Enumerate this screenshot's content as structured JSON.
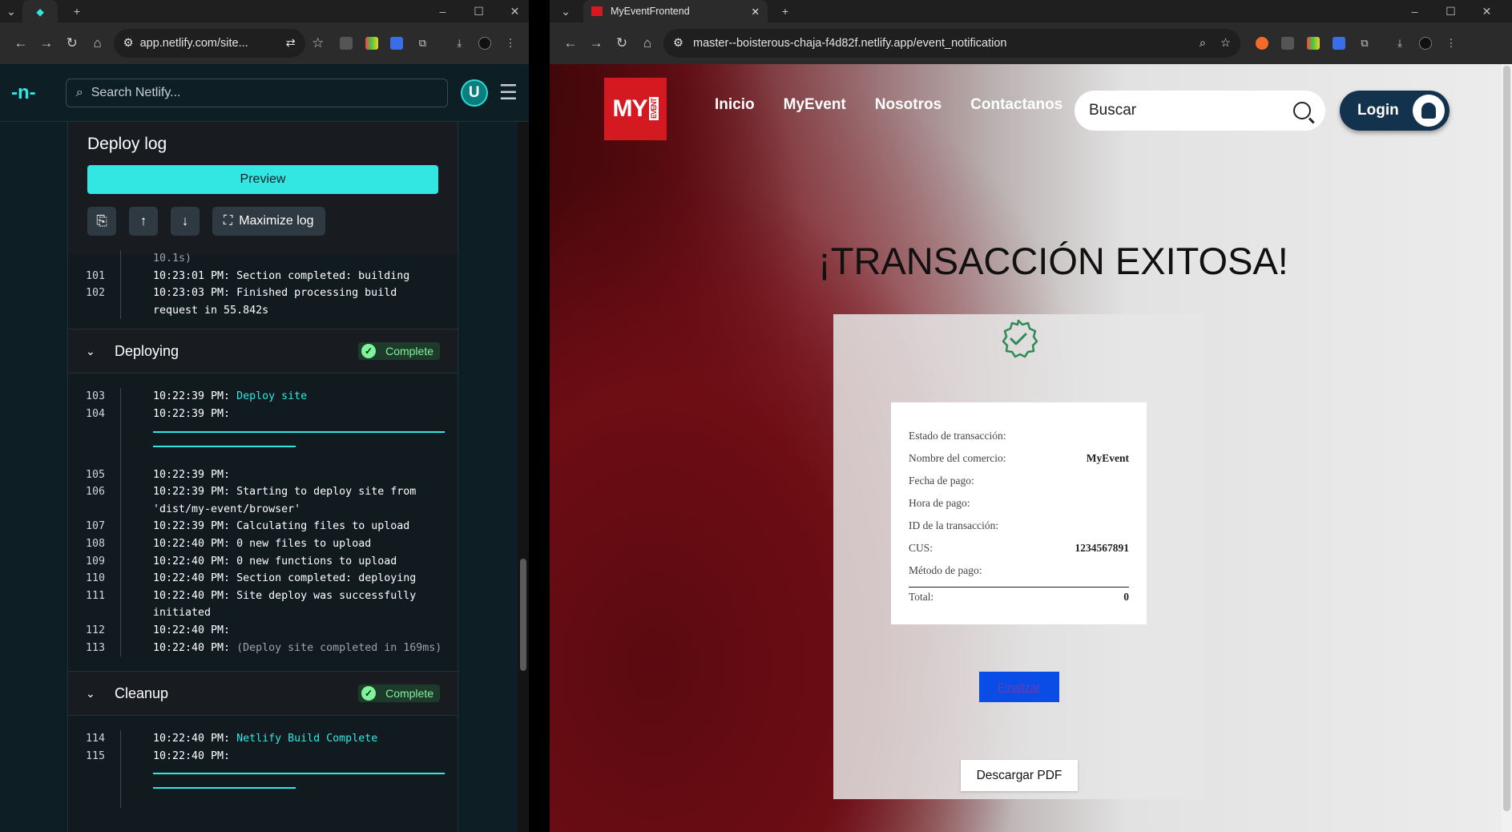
{
  "left_browser": {
    "url": "app.netlify.com/site...",
    "netlify": {
      "search_placeholder": "Search Netlify...",
      "avatar_initial": "U",
      "deploy_log_title": "Deploy log",
      "preview_label": "Preview",
      "maximize_label": "Maximize log",
      "log_top": [
        {
          "num": "",
          "text": "10.1s)",
          "cls": "dim"
        },
        {
          "num": "101",
          "text": "10:23:01 PM: Section completed: building"
        },
        {
          "num": "102",
          "text": "10:23:03 PM: Finished processing build request in 55.842s"
        }
      ],
      "sections": [
        {
          "title": "Deploying",
          "status": "Complete"
        },
        {
          "title": "Cleanup",
          "status": "Complete"
        }
      ],
      "log_deploying": [
        {
          "num": "103",
          "time": "10:22:39 PM:",
          "msg": "Deploy site",
          "cls": "hl"
        },
        {
          "num": "104",
          "time": "10:22:39 PM:",
          "msg": ""
        },
        {
          "num": "105",
          "time": "10:22:39 PM:",
          "msg": ""
        },
        {
          "num": "106",
          "time": "10:22:39 PM:",
          "msg": "Starting to deploy site from 'dist/my-event/browser'"
        },
        {
          "num": "107",
          "time": "10:22:39 PM:",
          "msg": "Calculating files to upload"
        },
        {
          "num": "108",
          "time": "10:22:40 PM:",
          "msg": "0 new files to upload"
        },
        {
          "num": "109",
          "time": "10:22:40 PM:",
          "msg": "0 new functions to upload"
        },
        {
          "num": "110",
          "time": "10:22:40 PM:",
          "msg": "Section completed: deploying"
        },
        {
          "num": "111",
          "time": "10:22:40 PM:",
          "msg": "Site deploy was successfully initiated"
        },
        {
          "num": "112",
          "time": "10:22:40 PM:",
          "msg": ""
        },
        {
          "num": "113",
          "time": "10:22:40 PM:",
          "msg": "(Deploy site completed in 169ms)",
          "cls": "dim"
        }
      ],
      "log_cleanup": [
        {
          "num": "114",
          "time": "10:22:40 PM:",
          "msg": "Netlify Build Complete",
          "cls": "hl"
        },
        {
          "num": "115",
          "time": "10:22:40 PM:",
          "msg": ""
        }
      ]
    }
  },
  "right_browser": {
    "tab_title": "MyEventFrontend",
    "url": "master--boisterous-chaja-f4d82f.netlify.app/event_notification",
    "site": {
      "logo_text": "MY",
      "logo_sub": "EVENT",
      "nav": [
        "Inicio",
        "MyEvent",
        "Nosotros",
        "Contactanos"
      ],
      "search_placeholder": "Buscar",
      "login_label": "Login",
      "headline": "¡TRANSACCIÓN EXITOSA!",
      "receipt": [
        {
          "label": "Estado de transacción:",
          "value": ""
        },
        {
          "label": "Nombre del comercio:",
          "value": "MyEvent"
        },
        {
          "label": "Fecha de pago:",
          "value": ""
        },
        {
          "label": "Hora de pago:",
          "value": ""
        },
        {
          "label": "ID de la transacción:",
          "value": ""
        },
        {
          "label": "CUS:",
          "value": "1234567891"
        },
        {
          "label": "Método de pago:",
          "value": ""
        }
      ],
      "total_label": "Total:",
      "total_value": "0",
      "finalizar_label": "Finalizar",
      "pdf_label": "Descargar PDF"
    }
  },
  "colors": {
    "netlify_accent": "#32e6e2",
    "site_red": "#d41920",
    "login_navy": "#12324e",
    "finalizar_blue": "#0a4de6"
  }
}
